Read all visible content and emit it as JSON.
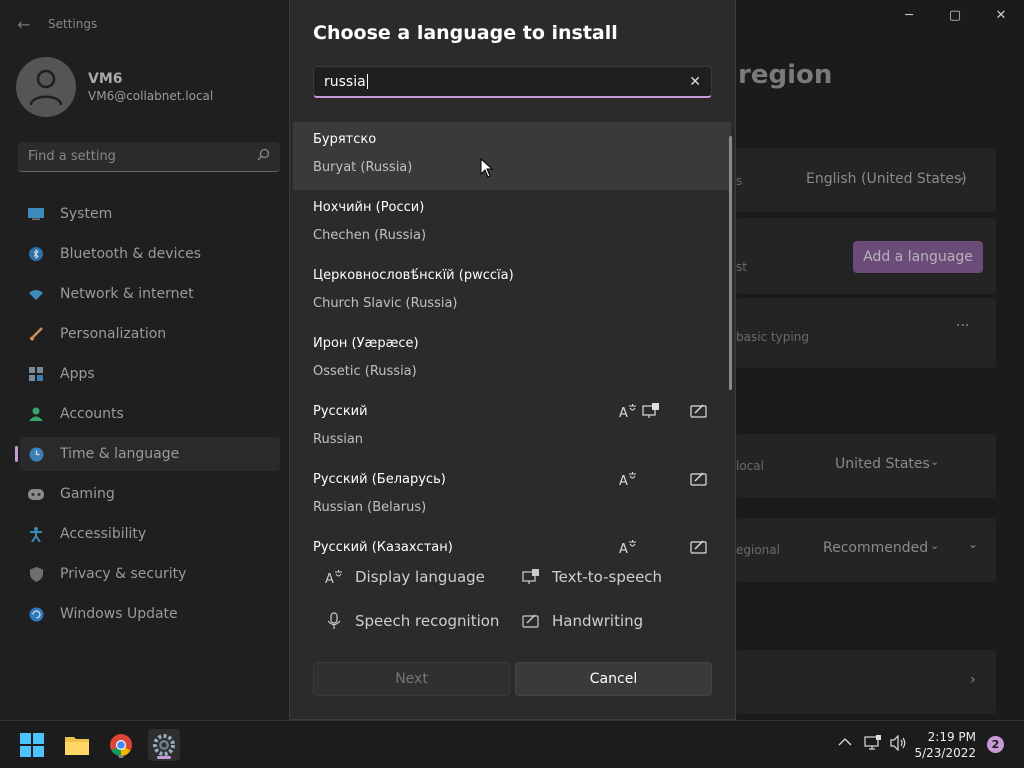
{
  "window": {
    "app_title": "Settings",
    "back_icon": "back-arrow-icon",
    "controls": {
      "minimize": "─",
      "maximize": "▢",
      "close": "✕"
    }
  },
  "profile": {
    "name": "VM6",
    "email": "VM6@collabnet.local"
  },
  "nav_search": {
    "placeholder": "Find a setting"
  },
  "nav": {
    "items": [
      {
        "label": "System",
        "icon": "system-icon"
      },
      {
        "label": "Bluetooth & devices",
        "icon": "bluetooth-icon"
      },
      {
        "label": "Network & internet",
        "icon": "network-icon"
      },
      {
        "label": "Personalization",
        "icon": "brush-icon"
      },
      {
        "label": "Apps",
        "icon": "apps-icon"
      },
      {
        "label": "Accounts",
        "icon": "accounts-icon"
      },
      {
        "label": "Time & language",
        "icon": "time-language-icon",
        "selected": true
      },
      {
        "label": "Gaming",
        "icon": "gaming-icon"
      },
      {
        "label": "Accessibility",
        "icon": "accessibility-icon"
      },
      {
        "label": "Privacy & security",
        "icon": "shield-icon"
      },
      {
        "label": "Windows Update",
        "icon": "update-icon"
      }
    ]
  },
  "background": {
    "heading_fragment": "region",
    "display_language_value": "English (United States)",
    "add_language_label": "Add a language",
    "basic_typing_fragment": "basic typing",
    "country_value": "United States",
    "regional_format_value": "Recommended",
    "frag_s": "s",
    "frag_st": "st",
    "frag_local": "local",
    "frag_regional": "egional",
    "more_glyph": "···"
  },
  "dialog": {
    "title": "Choose a language to install",
    "search_value": "russia",
    "clear_icon": "clear-icon",
    "languages": [
      {
        "native": "Бурятско",
        "english": "Buryat (Russia)",
        "features": []
      },
      {
        "native": "Нохчийн (Росси)",
        "english": "Chechen (Russia)",
        "features": []
      },
      {
        "native": "Церковнословѣ́нскїй (рwссїа)",
        "english": "Church Slavic (Russia)",
        "features": []
      },
      {
        "native": "Ирон (Уæрæсе)",
        "english": "Ossetic (Russia)",
        "features": []
      },
      {
        "native": "Русский",
        "english": "Russian",
        "features": [
          "display-language",
          "text-to-speech",
          "handwriting"
        ]
      },
      {
        "native": "Русский (Беларусь)",
        "english": "Russian (Belarus)",
        "features": [
          "display-language",
          "handwriting"
        ]
      },
      {
        "native": "Русский (Казахстан)",
        "english": "",
        "features": [
          "display-language",
          "handwriting"
        ]
      }
    ],
    "legend": {
      "display_language": "Display language",
      "text_to_speech": "Text-to-speech",
      "speech_recognition": "Speech recognition",
      "handwriting": "Handwriting"
    },
    "next_label": "Next",
    "cancel_label": "Cancel"
  },
  "taskbar": {
    "apps": [
      "windows-start-icon",
      "file-explorer-icon",
      "chrome-icon",
      "settings-icon"
    ],
    "time": "2:19 PM",
    "date": "5/23/2022",
    "notification_count": "2"
  },
  "colors": {
    "accent": "#c59ad6",
    "dialog_bg": "#2b2b2b",
    "page_bg": "#1b1b1b"
  }
}
